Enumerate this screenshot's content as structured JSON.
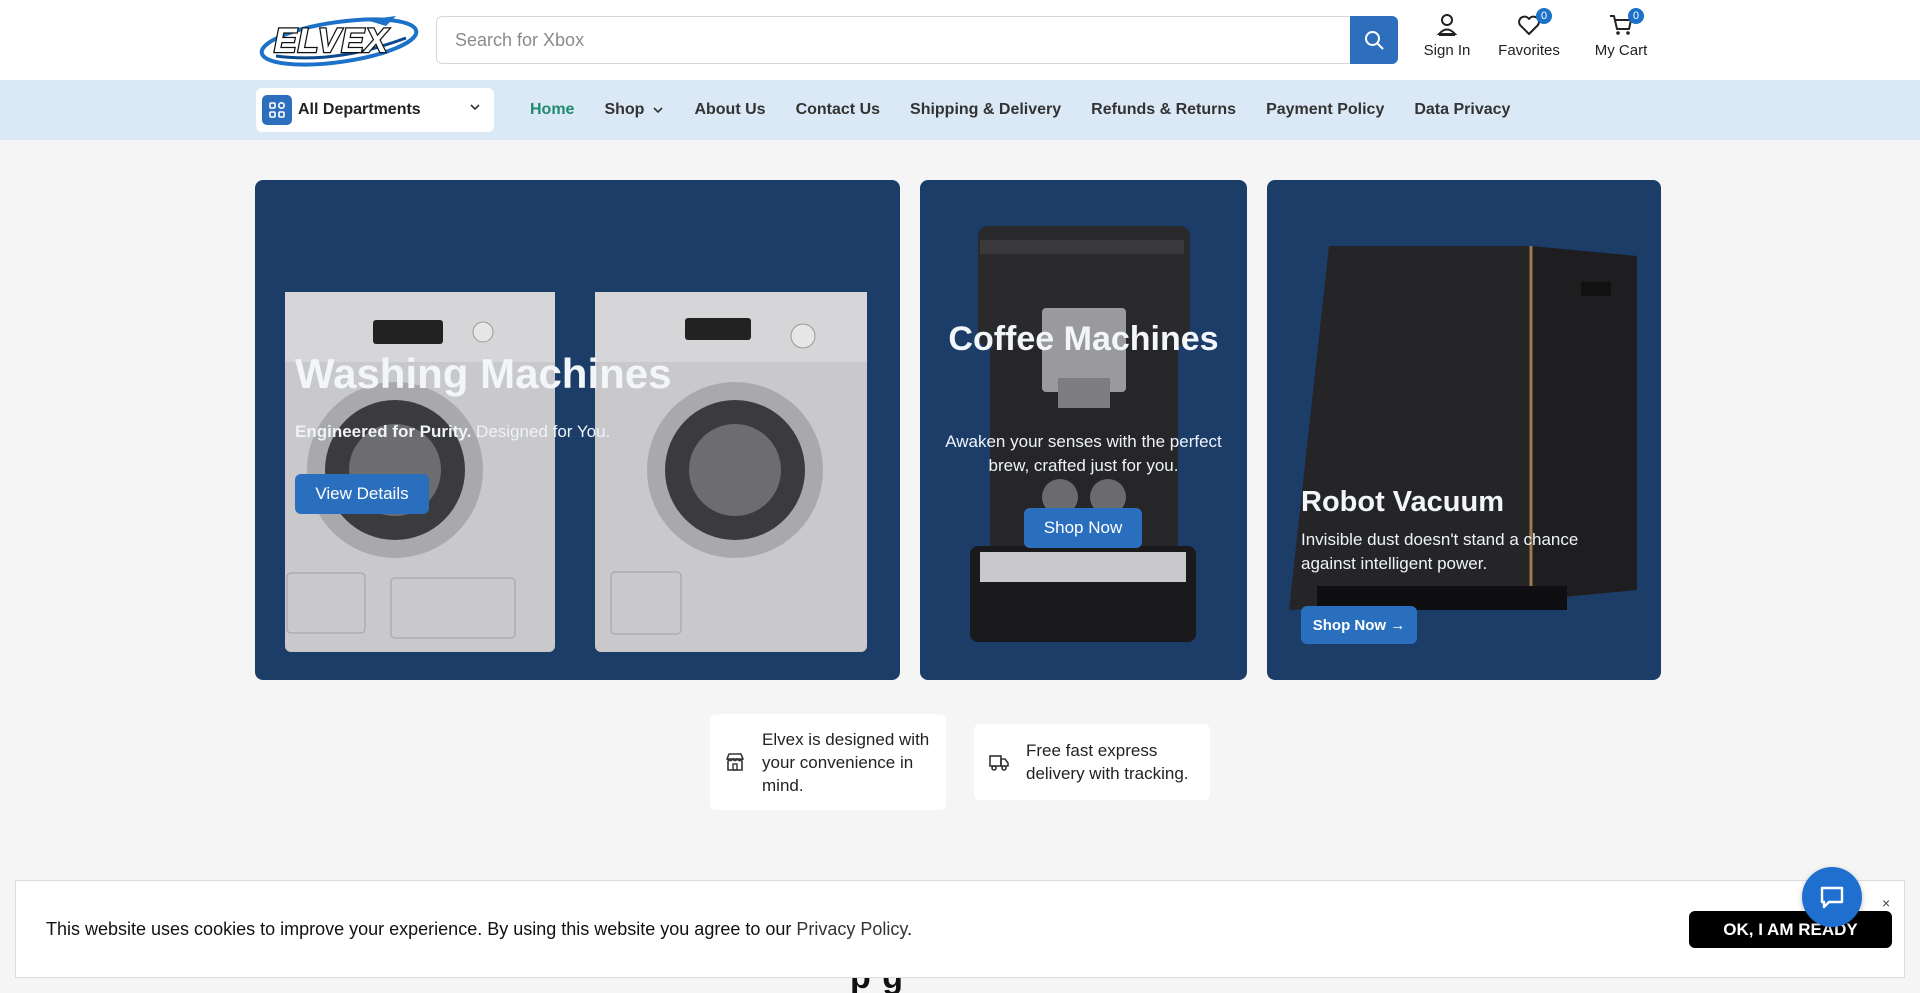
{
  "brand": {
    "logo_text": "ELVEX"
  },
  "search": {
    "placeholder": "Search for Xbox"
  },
  "header_actions": {
    "sign_in": "Sign In",
    "favorites": "Favorites",
    "favorites_count": "0",
    "cart": "My Cart",
    "cart_count": "0"
  },
  "departments": {
    "label": "All Departments"
  },
  "nav": {
    "home": "Home",
    "shop": "Shop",
    "about": "About Us",
    "contact": "Contact Us",
    "shipping": "Shipping & Delivery",
    "refunds": "Refunds & Returns",
    "payment": "Payment Policy",
    "privacy": "Data Privacy"
  },
  "hero": {
    "washing": {
      "title": "Washing Machines",
      "sub_bold": "Engineered for Purity.",
      "sub_rest": " Designed for You.",
      "button": "View Details"
    },
    "coffee": {
      "title": "Coffee Machines",
      "sub": "Awaken your senses with the perfect brew, crafted just for you.",
      "button": "Shop Now"
    },
    "vacuum": {
      "title": "Robot Vacuum",
      "sub": "Invisible dust doesn't stand a chance against intelligent power.",
      "button": "Shop Now →"
    }
  },
  "features": {
    "convenience": "Elvex is designed with your convenience in mind.",
    "delivery": "Free fast express delivery with tracking."
  },
  "cookie": {
    "text": "This website uses cookies to improve your experience. By using this website you agree to our",
    "link": "Privacy Policy",
    "after_link": ".",
    "button": "OK, I AM READY",
    "close": "×"
  },
  "section_heading_partial": "p    g",
  "colors": {
    "primary": "#2d6fbd",
    "nav_bg": "#dbe9f7",
    "hero_card": "#1b3d68",
    "active_nav": "#1f8a6e",
    "chat": "#1f6fd1"
  }
}
